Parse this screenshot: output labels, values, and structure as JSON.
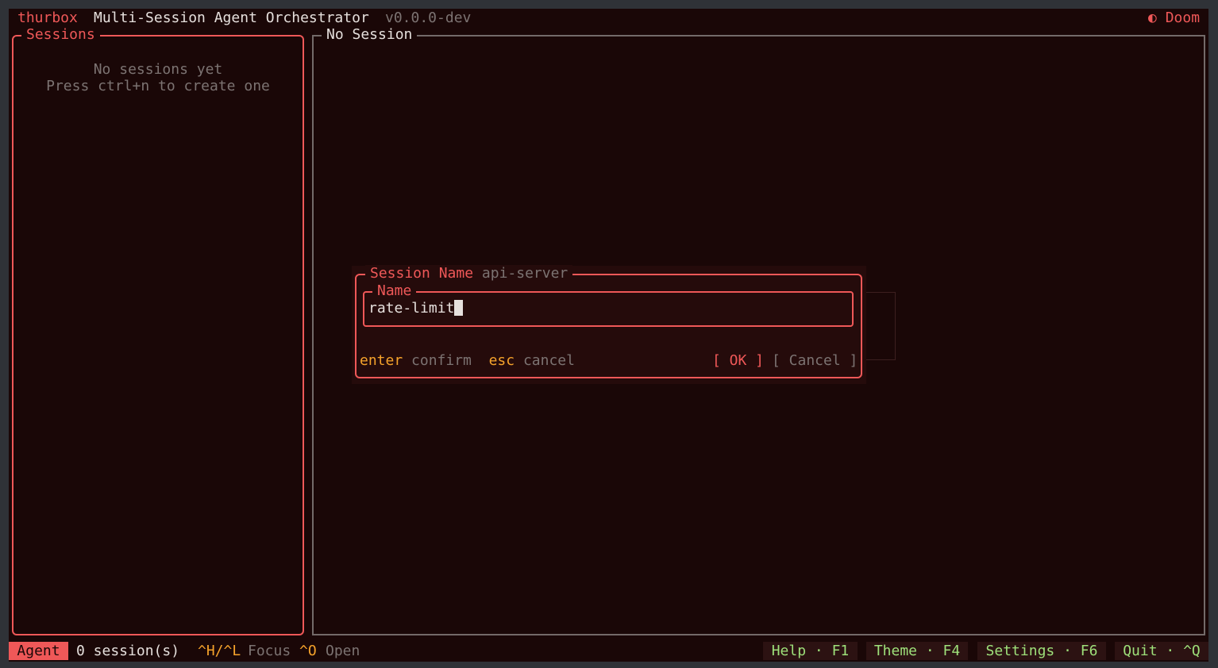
{
  "header": {
    "app_name": "thurbox",
    "subtitle": "Multi-Session Agent Orchestrator",
    "version": "v0.0.0-dev",
    "theme_icon": "moon-icon",
    "theme_icon_glyph": "◐",
    "theme_name": "Doom"
  },
  "sessions_panel": {
    "title": "Sessions",
    "empty_line1": "No sessions yet",
    "empty_line2": "Press ctrl+n to create one"
  },
  "main_panel": {
    "title": "No Session"
  },
  "dialog": {
    "title": "Session Name",
    "project": "api-server",
    "field_label": "Name",
    "field_value": "rate-limit",
    "hint_enter_key": "enter",
    "hint_enter_action": "confirm",
    "hint_esc_key": "esc",
    "hint_esc_action": "cancel",
    "ok_label": "[ OK ]",
    "cancel_label": "[ Cancel ]"
  },
  "statusbar": {
    "mode": "Agent",
    "session_count": "0 session(s)",
    "focus_key": "^H/^L",
    "focus_label": "Focus",
    "open_key": "^O",
    "open_label": "Open",
    "help": "Help · F1",
    "theme": "Theme · F4",
    "settings": "Settings · F6",
    "quit": "Quit · ^Q"
  },
  "colors": {
    "accent": "#ef5858",
    "background": "#1a0707",
    "key_hint": "#f6a32b",
    "function_key": "#9ee07a",
    "muted": "#7c7372"
  }
}
